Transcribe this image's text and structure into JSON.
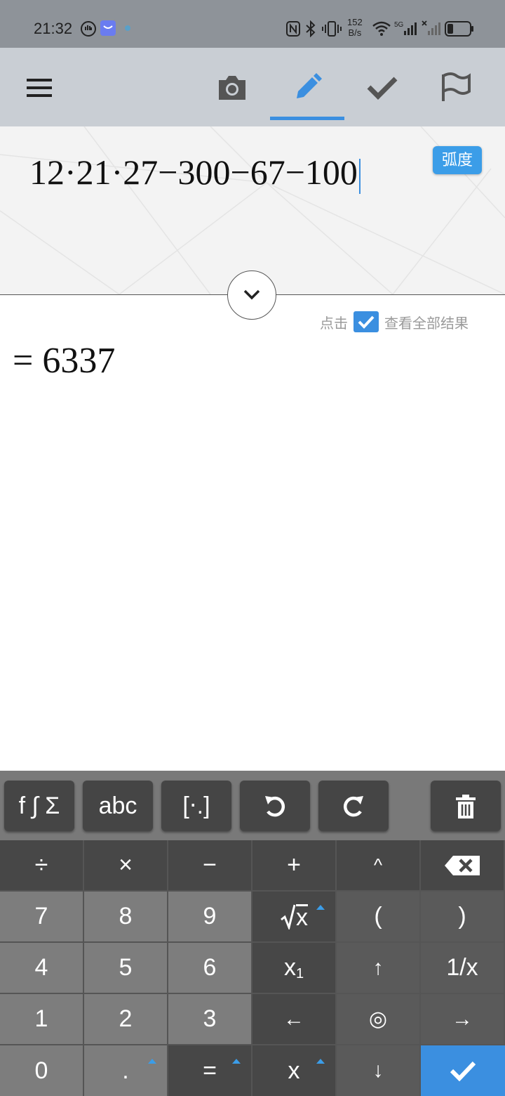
{
  "status_bar": {
    "time": "21:32",
    "net_speed_value": "152",
    "net_speed_unit": "B/s"
  },
  "app_bar": {
    "tabs": [
      "camera",
      "edit",
      "check",
      "flag"
    ],
    "active_tab": "edit",
    "accent_color": "#3b8fe0"
  },
  "editor": {
    "expression": "12·21·27−300−67−100",
    "angle_mode": "弧度"
  },
  "hint": {
    "prefix": "点击",
    "suffix": "查看全部结果"
  },
  "result": {
    "text": "= 6337"
  },
  "toolbar": {
    "functions": "f ∫ Σ",
    "letters": "abc",
    "matrix": "[⋅.]"
  },
  "keypad": {
    "row1": [
      "÷",
      "×",
      "−",
      "+",
      "^"
    ],
    "digits": {
      "k7": "7",
      "k8": "8",
      "k9": "9",
      "k4": "4",
      "k5": "5",
      "k6": "6",
      "k1": "1",
      "k2": "2",
      "k3": "3",
      "k0": "0"
    },
    "sqrt_x": "x",
    "open_paren": "(",
    "close_paren": ")",
    "subscript_x": "x",
    "subscript_1": "1",
    "reciprocal": "1/x",
    "up_arrow": "↑",
    "left_arrow": "←",
    "target": "◎",
    "right_arrow": "→",
    "decimal": ".",
    "equals": "=",
    "variable_x": "x",
    "down_arrow": "↓"
  }
}
